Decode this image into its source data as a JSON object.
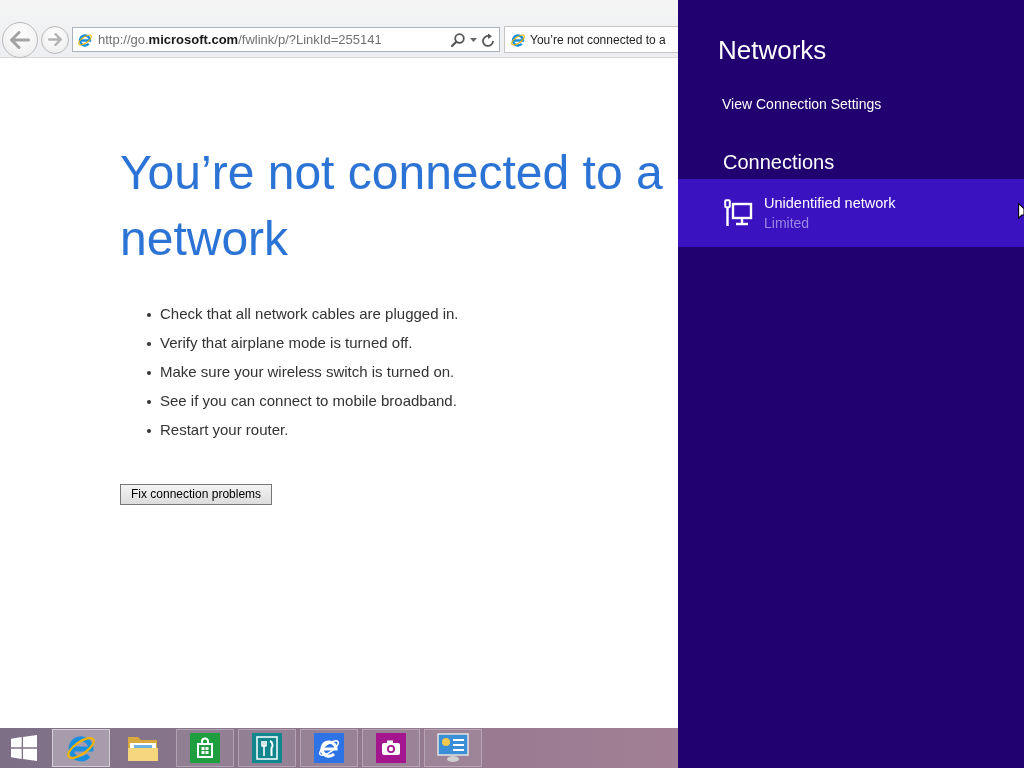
{
  "browser": {
    "address_bar": {
      "url": "http://go.**microsoft.com**/fwlink/p/?LinkId=255141"
    },
    "tab": {
      "title": "You’re not connected to a"
    }
  },
  "page": {
    "heading": "You’re not connected to a network",
    "tips": [
      "Check that all network cables are plugged in.",
      "Verify that airplane mode is turned off.",
      "Make sure your wireless switch is turned on.",
      "See if you can connect to mobile broadband.",
      "Restart your router."
    ],
    "button": "Fix connection problems"
  },
  "taskbar": {
    "items": [
      {
        "kind": "start",
        "running": false,
        "active": false
      },
      {
        "kind": "browser",
        "running": true,
        "active": true
      },
      {
        "kind": "folder",
        "running": false,
        "active": false
      },
      {
        "kind": "store",
        "running": true,
        "active": false
      },
      {
        "kind": "food",
        "running": true,
        "active": false
      },
      {
        "kind": "browser-tile",
        "running": true,
        "active": false
      },
      {
        "kind": "camera",
        "running": true,
        "active": false
      },
      {
        "kind": "control-panel",
        "running": true,
        "active": false
      }
    ]
  },
  "networks_panel": {
    "title": "Networks",
    "settings_link": "View Connection Settings",
    "section_title": "Connections",
    "connections": [
      {
        "name": "Unidentified network",
        "status": "Limited",
        "selected": true
      }
    ]
  }
}
